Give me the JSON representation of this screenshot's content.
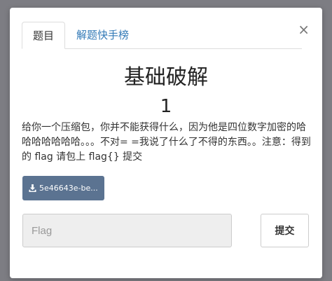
{
  "tabs": {
    "challenge": "题目",
    "writeup": "解题快手榜"
  },
  "close_symbol": "×",
  "challenge": {
    "title": "基础破解",
    "score": "1",
    "description": "给你一个压缩包，你并不能获得什么，因为他是四位数字加密的哈哈哈哈哈哈哈。。。不对= =我说了什么了不得的东西。。注意：得到的 flag 请包上 flag{} 提交",
    "attachment_label": "5e46643e-be..."
  },
  "form": {
    "flag_placeholder": "Flag",
    "submit_label": "提交"
  },
  "colors": {
    "backdrop": "#7d7d83",
    "link": "#337ab7",
    "download_button": "#5b7391"
  },
  "icons": {
    "close": "close-icon",
    "download": "download-icon"
  }
}
